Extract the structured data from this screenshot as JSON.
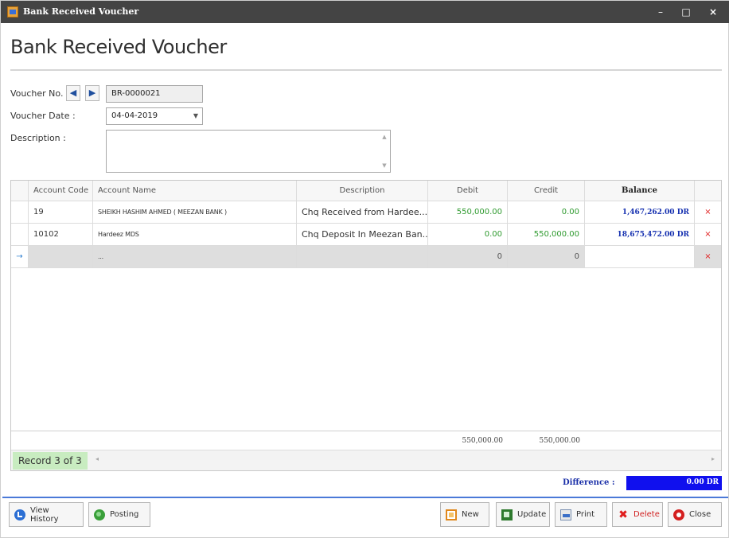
{
  "window": {
    "title": "Bank Received Voucher",
    "controls": {
      "minimize": "–",
      "maximize": "□",
      "close": "×"
    }
  },
  "form": {
    "heading": "Bank Received Voucher",
    "voucher_no_label": "Voucher No.",
    "nav_first": "◀",
    "nav_last": "▶",
    "voucher_no_value": "BR-0000021",
    "voucher_date_label": "Voucher Date :",
    "voucher_date_value": "04-04-2019",
    "description_label": "Description :",
    "description_value": ""
  },
  "grid": {
    "columns": [
      "Account Code",
      "Account Name",
      "Description",
      "Debit",
      "Credit",
      "Balance"
    ],
    "rows": [
      {
        "code": "19",
        "name": "SHEIKH HASHIM AHMED ( MEEZAN BANK )",
        "description": "Chq Received from Hardee...",
        "debit": "550,000.00",
        "credit": "0.00",
        "balance": "1,467,262.00 DR",
        "delete": "×"
      },
      {
        "code": "10102",
        "name": "Hardeez MDS",
        "description": "Chq Deposit In Meezan Ban...",
        "debit": "0.00",
        "credit": "550,000.00",
        "balance": "18,675,472.00 DR",
        "delete": "×"
      }
    ],
    "new_row": {
      "indicator": "→",
      "name": "...",
      "debit": "0",
      "credit": "0",
      "delete": "×"
    },
    "totals": {
      "debit": "550,000.00",
      "credit": "550,000.00"
    },
    "record_text": "Record 3 of 3",
    "scroll_left": "◂",
    "scroll_right": "▸"
  },
  "difference": {
    "label": "Difference :",
    "value": "0.00 DR",
    "color": "#1010ee"
  },
  "buttons": {
    "view_history": "View History",
    "posting": "Posting",
    "new": "New",
    "update": "Update",
    "print": "Print",
    "delete": "Delete",
    "close": "Close"
  },
  "icons": {
    "view_history": "history-icon",
    "posting": "posting-icon",
    "new": "new-document-icon",
    "update": "update-icon",
    "print": "print-icon",
    "delete": "delete-x-icon",
    "close": "close-circle-icon"
  }
}
